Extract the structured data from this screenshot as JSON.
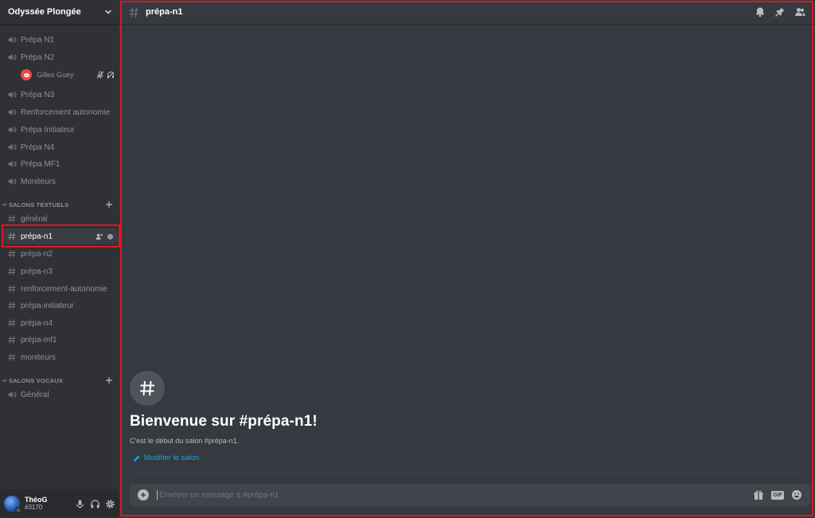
{
  "server": {
    "name": "Odyssée Plongée"
  },
  "voice_channels_top": [
    {
      "label": "Prépa N1"
    },
    {
      "label": "Prépa N2"
    },
    {
      "label": "Prépa N3"
    },
    {
      "label": "Renforcement autonomie"
    },
    {
      "label": "Prépa Initiateur"
    },
    {
      "label": "Prépa N4"
    },
    {
      "label": "Prépa MF1"
    },
    {
      "label": "Moniteurs"
    }
  ],
  "voice_user": {
    "name": "Gilles Guey",
    "avatar_color": "#f04747"
  },
  "text_category": {
    "label": "SALONS TEXTUELS"
  },
  "text_channels": [
    {
      "label": "général"
    },
    {
      "label": "prépa-n1"
    },
    {
      "label": "prépa-n2"
    },
    {
      "label": "prépa-n3"
    },
    {
      "label": "renforcement-autonomie"
    },
    {
      "label": "prépa-initiateur"
    },
    {
      "label": "prépa-n4"
    },
    {
      "label": "prépa-mf1"
    },
    {
      "label": "moniteurs"
    }
  ],
  "active_channel_index": 1,
  "voice_category": {
    "label": "SALONS VOCAUX"
  },
  "voice_channels_bottom": [
    {
      "label": "Général"
    }
  ],
  "user": {
    "name": "ThéoG",
    "tag": "#3170"
  },
  "header": {
    "channel_name": "prépa-n1"
  },
  "welcome": {
    "title": "Bienvenue sur #prépa-n1!",
    "subtitle": "C'est le début du salon #prépa-n1.",
    "edit_label": "Modifier le salon"
  },
  "composer": {
    "placeholder": "Envoyer un message à #prépa-n1",
    "value": "",
    "gif_label": "GIF"
  },
  "colors": {
    "sidebar_bg": "#2f3136",
    "main_bg": "#36393f",
    "highlight_border": "#e0161e",
    "link": "#00b0f4",
    "user_panel_bg": "#292b2f"
  },
  "icons": [
    "speaker-icon",
    "hash-icon",
    "bell-icon",
    "pin-icon",
    "members-icon",
    "gift-icon",
    "gif-icon",
    "emoji-icon",
    "mic-icon",
    "headphones-icon",
    "gear-icon",
    "add-member-icon",
    "plus-icon",
    "pencil-icon"
  ]
}
